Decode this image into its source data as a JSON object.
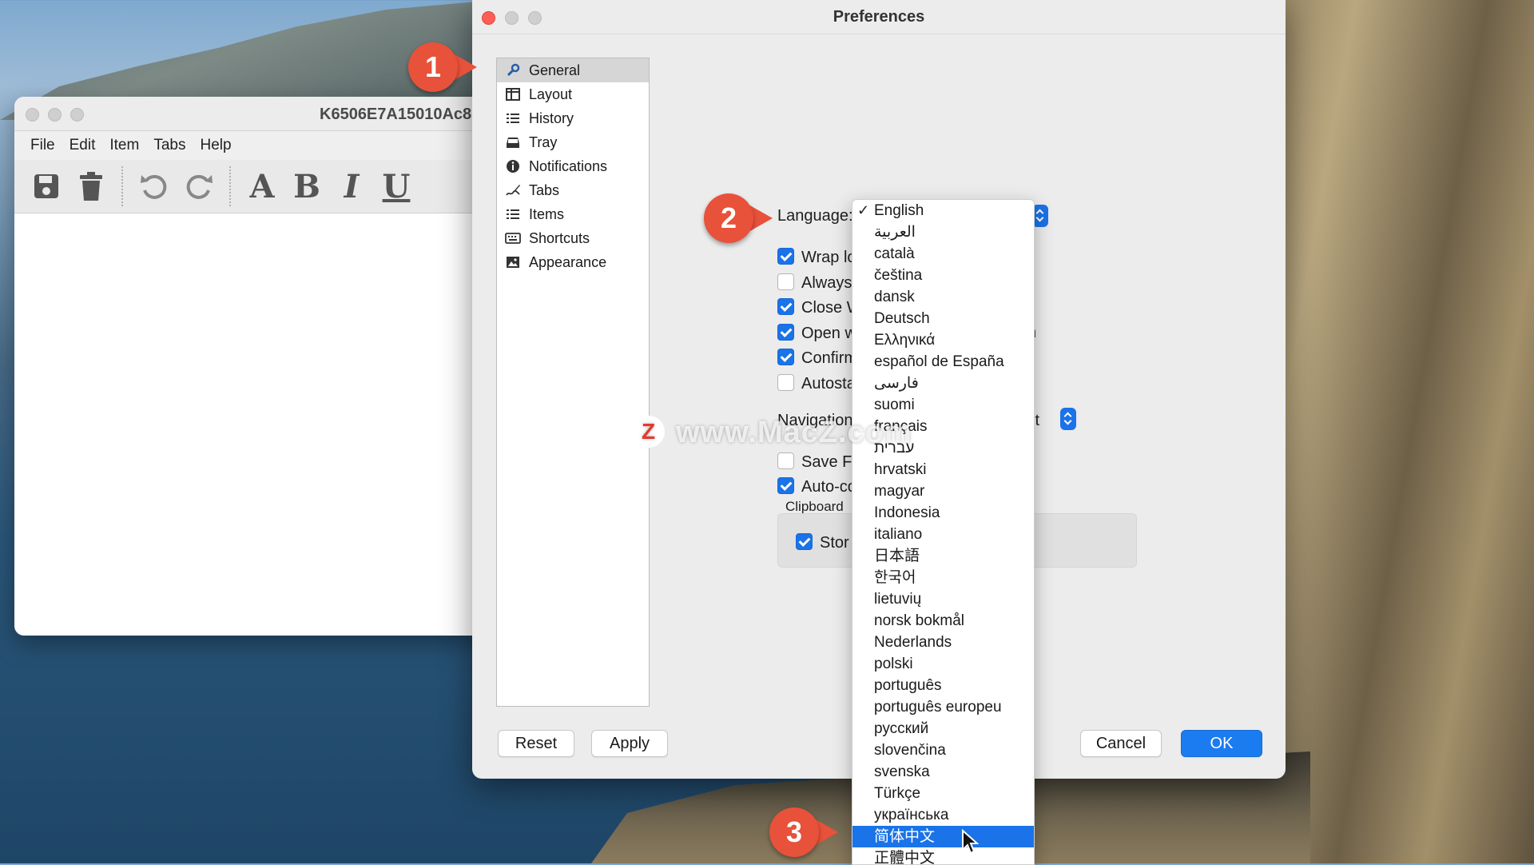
{
  "editor": {
    "title": "K6506E7A15010Ac8",
    "menu": [
      "File",
      "Edit",
      "Item",
      "Tabs",
      "Help"
    ]
  },
  "prefs": {
    "title": "Preferences",
    "sidebar": [
      {
        "label": "General",
        "icon": "wrench-icon"
      },
      {
        "label": "Layout",
        "icon": "layout-icon"
      },
      {
        "label": "History",
        "icon": "list-icon"
      },
      {
        "label": "Tray",
        "icon": "tray-icon"
      },
      {
        "label": "Notifications",
        "icon": "info-icon"
      },
      {
        "label": "Tabs",
        "icon": "signature-icon"
      },
      {
        "label": "Items",
        "icon": "list-icon"
      },
      {
        "label": "Shortcuts",
        "icon": "keyboard-icon"
      },
      {
        "label": "Appearance",
        "icon": "image-icon"
      }
    ],
    "language_label": "Language:",
    "checks": [
      {
        "label": "Wrap lo",
        "checked": true
      },
      {
        "label": "Always",
        "checked": false
      },
      {
        "label": "Close W",
        "checked": true
      },
      {
        "label": "Open w",
        "checked": true
      },
      {
        "label": "Confirm",
        "checked": true
      },
      {
        "label": "Autosta",
        "checked": false
      }
    ],
    "navigation_label": "Navigation",
    "navigation_value_tail": "lt",
    "open_row_tail": "n",
    "checks2": [
      {
        "label": "Save Fi",
        "checked": false
      },
      {
        "label": "Auto-co",
        "checked": true
      }
    ],
    "clipboard_label": "Clipboard",
    "store_label": "Stor",
    "buttons": {
      "reset": "Reset",
      "apply": "Apply",
      "cancel": "Cancel",
      "ok": "OK"
    }
  },
  "dropdown": {
    "selected": "English",
    "highlighted": "简体中文",
    "options": [
      "English",
      "العربية",
      "català",
      "čeština",
      "dansk",
      "Deutsch",
      "Ελληνικά",
      "español de España",
      "فارسی",
      "suomi",
      "français",
      "עברית",
      "hrvatski",
      "magyar",
      "Indonesia",
      "italiano",
      "日本語",
      "한국어",
      "lietuvių",
      "norsk bokmål",
      "Nederlands",
      "polski",
      "português",
      "português europeu",
      "русский",
      "slovenčina",
      "svenska",
      "Türkçe",
      "українська",
      "简体中文",
      "正體中文"
    ]
  },
  "callouts": [
    "1",
    "2",
    "3"
  ],
  "watermark": "www.MacZ.com",
  "watermark_logo": "Z",
  "colors": {
    "accent": "#1a73e8",
    "callout": "#e8513a"
  }
}
